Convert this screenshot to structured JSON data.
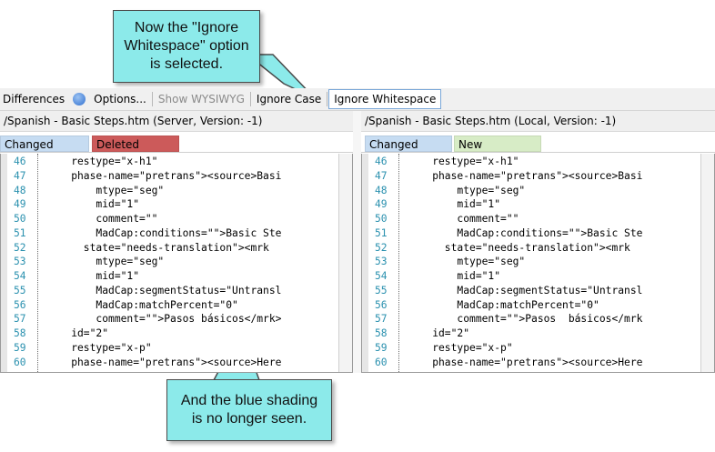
{
  "toolbar": {
    "differences": "Differences",
    "options": "Options...",
    "show_wysiwyg": "Show WYSIWYG",
    "ignore_case": "Ignore Case",
    "ignore_whitespace": "Ignore Whitespace"
  },
  "left_pane": {
    "path": "/Spanish - Basic Steps.htm  (Server, Version: -1)",
    "legend": [
      {
        "label": "Changed",
        "color": "#c6dcf2"
      },
      {
        "label": "Deleted",
        "color": "#cc5a5a"
      }
    ],
    "lines": [
      {
        "num": "46",
        "text": "    restype=\"x-h1\""
      },
      {
        "num": "47",
        "text": "    phase-name=\"pretrans\"><source>Basi"
      },
      {
        "num": "48",
        "text": "        mtype=\"seg\""
      },
      {
        "num": "49",
        "text": "        mid=\"1\""
      },
      {
        "num": "50",
        "text": "        comment=\"\""
      },
      {
        "num": "51",
        "text": "        MadCap:conditions=\"\">Basic Ste"
      },
      {
        "num": "52",
        "text": "      state=\"needs-translation\"><mrk"
      },
      {
        "num": "53",
        "text": "        mtype=\"seg\""
      },
      {
        "num": "54",
        "text": "        mid=\"1\""
      },
      {
        "num": "55",
        "text": "        MadCap:segmentStatus=\"Untransl"
      },
      {
        "num": "56",
        "text": "        MadCap:matchPercent=\"0\""
      },
      {
        "num": "57",
        "text": "        comment=\"\">Pasos básicos</mrk>"
      },
      {
        "num": "58",
        "text": "    id=\"2\""
      },
      {
        "num": "59",
        "text": "    restype=\"x-p\""
      },
      {
        "num": "60",
        "text": "    phase-name=\"pretrans\"><source>Here"
      }
    ]
  },
  "right_pane": {
    "path": "/Spanish - Basic Steps.htm  (Local, Version: -1)",
    "legend": [
      {
        "label": "Changed",
        "color": "#c6dcf2"
      },
      {
        "label": "New",
        "color": "#d7ecc6"
      }
    ],
    "lines": [
      {
        "num": "46",
        "text": "    restype=\"x-h1\""
      },
      {
        "num": "47",
        "text": "    phase-name=\"pretrans\"><source>Basi"
      },
      {
        "num": "48",
        "text": "        mtype=\"seg\""
      },
      {
        "num": "49",
        "text": "        mid=\"1\""
      },
      {
        "num": "50",
        "text": "        comment=\"\""
      },
      {
        "num": "51",
        "text": "        MadCap:conditions=\"\">Basic Ste"
      },
      {
        "num": "52",
        "text": "      state=\"needs-translation\"><mrk"
      },
      {
        "num": "53",
        "text": "        mtype=\"seg\""
      },
      {
        "num": "54",
        "text": "        mid=\"1\""
      },
      {
        "num": "55",
        "text": "        MadCap:segmentStatus=\"Untransl"
      },
      {
        "num": "56",
        "text": "        MadCap:matchPercent=\"0\""
      },
      {
        "num": "57",
        "text": "        comment=\"\">Pasos  básicos</mrk"
      },
      {
        "num": "58",
        "text": "    id=\"2\""
      },
      {
        "num": "59",
        "text": "    restype=\"x-p\""
      },
      {
        "num": "60",
        "text": "    phase-name=\"pretrans\"><source>Here"
      }
    ]
  },
  "callouts": {
    "top": "Now the \"Ignore Whitespace\" option is selected.",
    "bottom": "And the blue shading is no longer seen."
  },
  "colors": {
    "callout_fill": "#8ceaea",
    "line_number": "#2b91af"
  }
}
